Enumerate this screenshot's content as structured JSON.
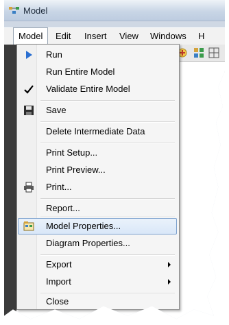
{
  "window": {
    "title": "Model"
  },
  "menubar": {
    "items": [
      {
        "label": "Model"
      },
      {
        "label": "Edit"
      },
      {
        "label": "Insert"
      },
      {
        "label": "View"
      },
      {
        "label": "Windows"
      },
      {
        "label": "H"
      }
    ]
  },
  "dropdown": {
    "items": [
      {
        "label": "Run",
        "icon": "run-arrow-icon"
      },
      {
        "label": "Run Entire Model"
      },
      {
        "label": "Validate Entire Model",
        "icon": "checkmark-icon"
      },
      {
        "label": "Save",
        "icon": "floppy-disk-icon"
      },
      {
        "label": "Delete Intermediate Data"
      },
      {
        "label": "Print Setup..."
      },
      {
        "label": "Print Preview..."
      },
      {
        "label": "Print...",
        "icon": "printer-icon"
      },
      {
        "label": "Report..."
      },
      {
        "label": "Model Properties...",
        "icon": "model-properties-icon",
        "highlighted": true
      },
      {
        "label": "Diagram Properties..."
      },
      {
        "label": "Export",
        "submenu": true
      },
      {
        "label": "Import",
        "submenu": true
      },
      {
        "label": "Close"
      }
    ]
  },
  "colors": {
    "highlight_border": "#7da2ce",
    "run_arrow": "#2a6fd1"
  }
}
